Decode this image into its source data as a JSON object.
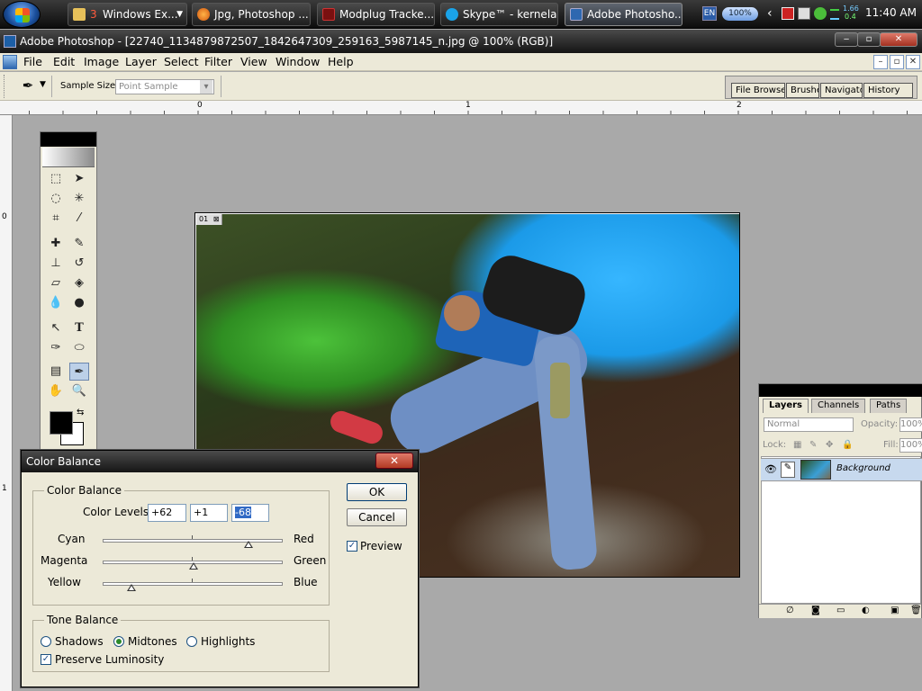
{
  "taskbar": {
    "items": [
      {
        "label": "Windows Ex...",
        "badge": "3"
      },
      {
        "label": "Jpg, Photoshop ..."
      },
      {
        "label": "Modplug Tracke..."
      },
      {
        "label": "Skype™ - kernela..."
      },
      {
        "label": "Adobe Photosho..."
      }
    ],
    "lang": "EN",
    "battery": "100%",
    "net_up": "1.66",
    "net_down": "0.4",
    "clock": "11:40 AM"
  },
  "window": {
    "title": "Adobe Photoshop - [22740_1134879872507_1842647309_259163_5987145_n.jpg @ 100% (RGB)]"
  },
  "menu": [
    "File",
    "Edit",
    "Image",
    "Layer",
    "Select",
    "Filter",
    "View",
    "Window",
    "Help"
  ],
  "options_bar": {
    "sample_size_label": "Sample Size:",
    "sample_size_value": "Point Sample"
  },
  "palette_well": [
    "File Browse",
    "Brushe",
    "Navigato",
    "History"
  ],
  "ruler": {
    "marks": [
      "0",
      "1",
      "2"
    ],
    "v_marks": [
      "0",
      "1"
    ]
  },
  "document": {
    "tab_label": "01"
  },
  "layers_panel": {
    "tabs": [
      "Layers",
      "Channels",
      "Paths"
    ],
    "blend_mode": "Normal",
    "opacity_label": "Opacity:",
    "opacity_value": "100%",
    "lock_label": "Lock:",
    "fill_label": "Fill:",
    "fill_value": "100%",
    "layer_name": "Background"
  },
  "dialog": {
    "title": "Color Balance",
    "color_balance_group": "Color Balance",
    "levels_label": "Color Levels:",
    "levels": [
      "+62",
      "+1",
      "-68"
    ],
    "sliders": [
      {
        "left": "Cyan",
        "right": "Red",
        "level": 62
      },
      {
        "left": "Magenta",
        "right": "Green",
        "level": 1
      },
      {
        "left": "Yellow",
        "right": "Blue",
        "level": -68
      }
    ],
    "ok_label": "OK",
    "cancel_label": "Cancel",
    "preview_label": "Preview",
    "preview_checked": true,
    "tone_group": "Tone Balance",
    "tones": [
      "Shadows",
      "Midtones",
      "Highlights"
    ],
    "tone_selected": "Midtones",
    "preserve_label": "Preserve Luminosity",
    "preserve_checked": true
  }
}
